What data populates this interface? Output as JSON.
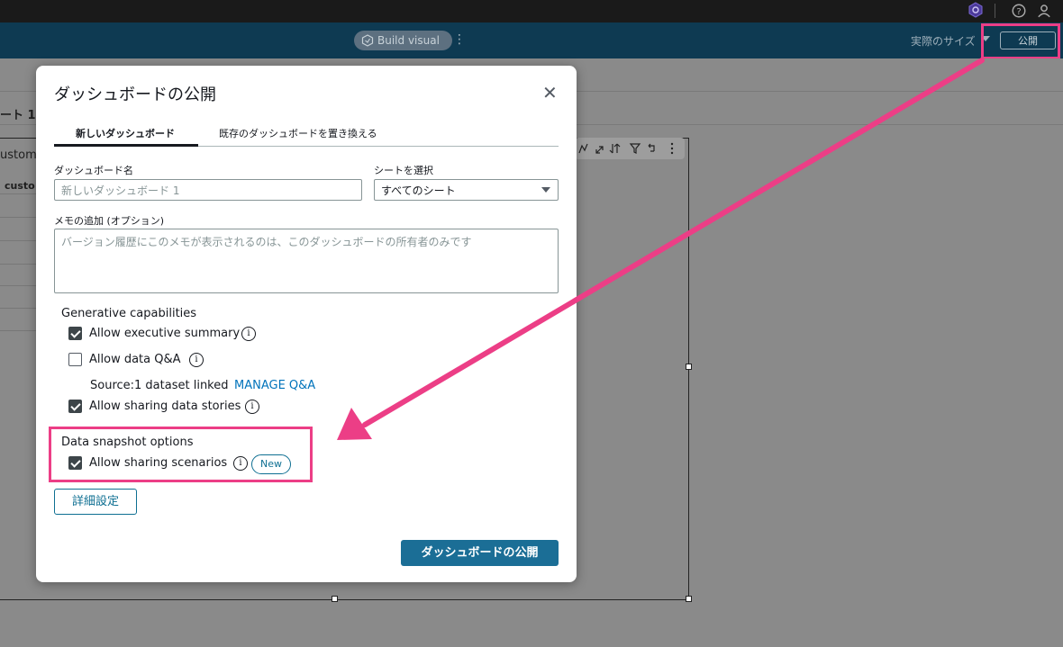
{
  "header": {
    "build_visual_label": "Build visual",
    "real_size_label": "実際のサイズ",
    "publish_label": "公開"
  },
  "workspace": {
    "sheet_tab_fragment": "ート 1",
    "field_fragment_1": "ustome",
    "field_fragment_2": "custo"
  },
  "modal": {
    "title": "ダッシュボードの公開",
    "close_glyph": "✕",
    "tabs": [
      {
        "label": "新しいダッシュボード",
        "active": true
      },
      {
        "label": "既存のダッシュボードを置き換える",
        "active": false
      }
    ],
    "dashboard_name_label": "ダッシュボード名",
    "dashboard_name_placeholder": "新しいダッシュボード 1",
    "sheet_select_label": "シートを選択",
    "sheet_select_value": "すべてのシート",
    "memo_label": "メモの追加 (オプション)",
    "memo_placeholder": "バージョン履歴にこのメモが表示されるのは、このダッシュボードの所有者のみです",
    "generative_heading": "Generative capabilities",
    "options": [
      {
        "label": "Allow executive summary",
        "checked": true
      },
      {
        "label": "Allow data Q&A",
        "checked": false
      },
      {
        "label": "Allow sharing data stories",
        "checked": true
      }
    ],
    "source_text": "Source:1 dataset linked",
    "manage_qa_link": "MANAGE Q&A",
    "snapshot_heading": "Data snapshot options",
    "snapshot_option": {
      "label": "Allow sharing scenarios",
      "checked": true
    },
    "new_badge": "New",
    "advanced_button": "詳細設定",
    "publish_button": "ダッシュボードの公開",
    "info_glyph": "i"
  },
  "colors": {
    "highlight": "#ec3e86",
    "header_bg": "#0e3a52",
    "primary_button": "#1b6e96",
    "link": "#0073bb"
  }
}
